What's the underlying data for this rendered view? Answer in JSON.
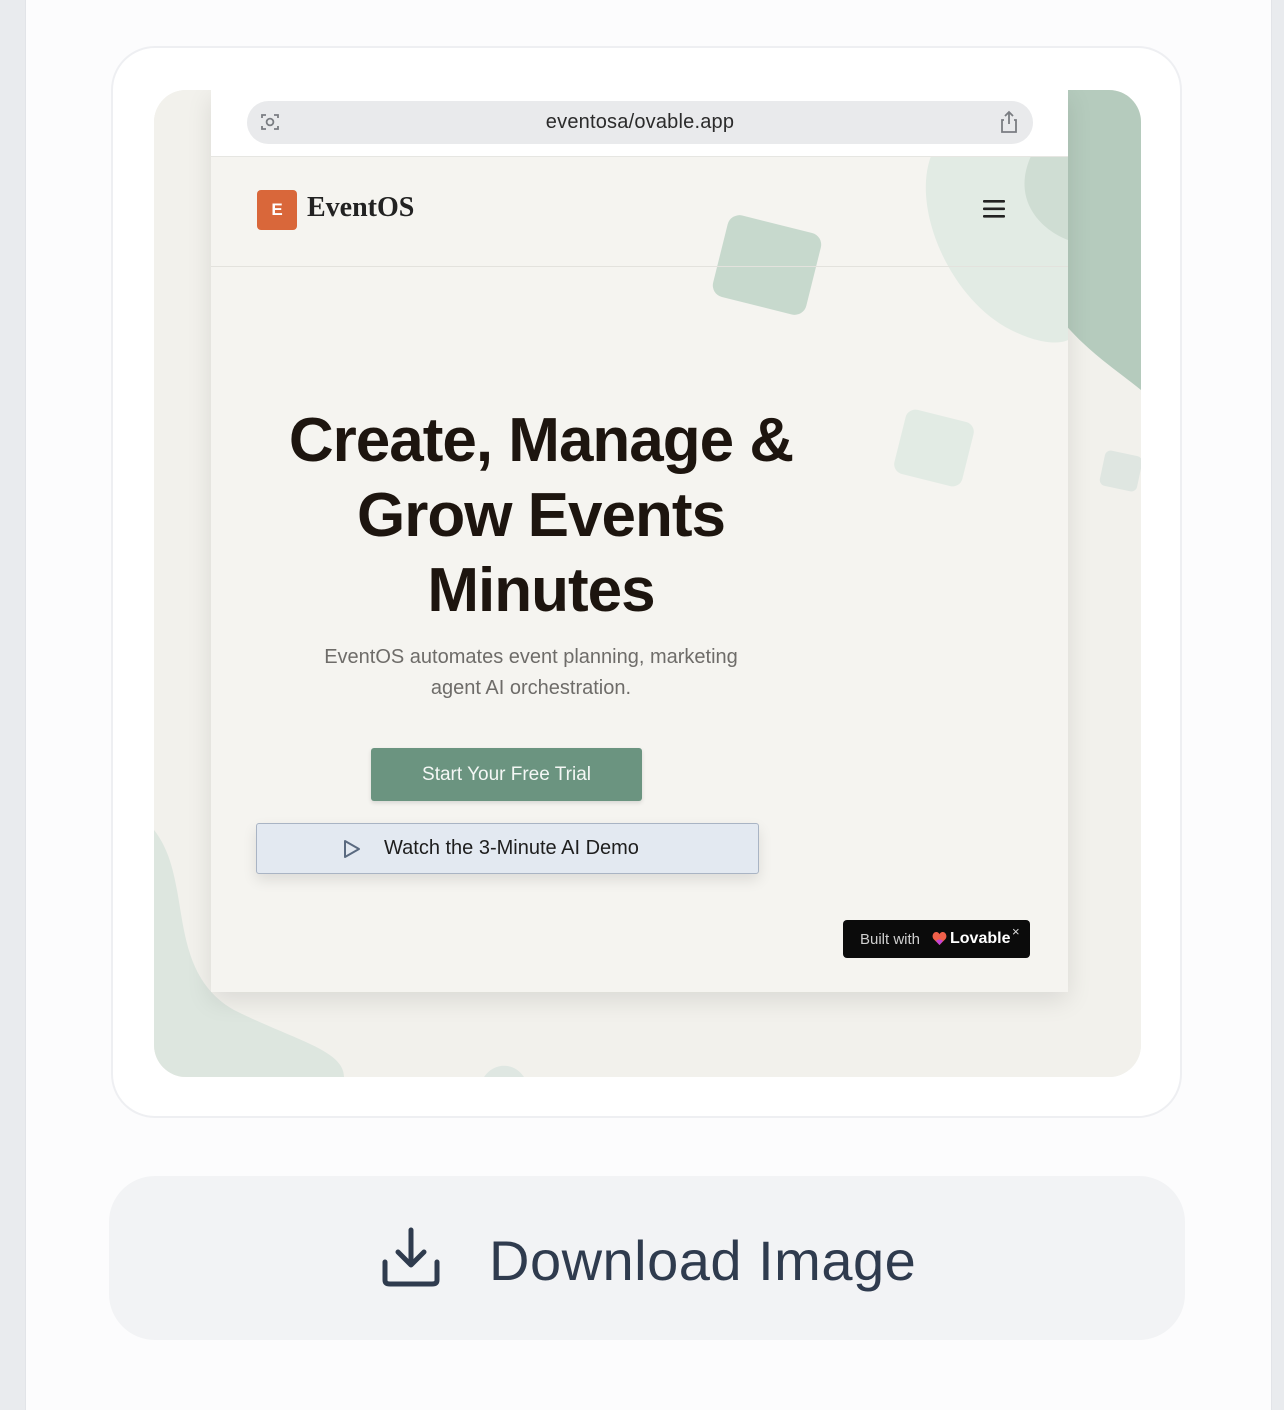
{
  "preview": {
    "browser": {
      "url": "eventosa/ovable.app",
      "icons": {
        "left": "camera-scan-icon",
        "right": "share-icon"
      }
    },
    "site": {
      "logo_letter": "E",
      "logo_text": "EventOS",
      "menu_icon": "hamburger-menu-icon",
      "hero_title_line1": "Create, Manage &",
      "hero_title_line2": "Grow Events",
      "hero_title_line3": "Minutes",
      "hero_subtitle_line1": "EventOS automates event planning, marketing",
      "hero_subtitle_line2": "agent AI orchestration.",
      "cta_primary": "Start Your Free Trial",
      "cta_secondary": "Watch the 3-Minute AI Demo",
      "badge_built": "Built with",
      "badge_brand": "Lovable",
      "badge_close": "×"
    },
    "colors": {
      "accent_green": "#6b9480",
      "logo_orange": "#d9673a",
      "page_bg": "#f5f4f0"
    }
  },
  "actions": {
    "download_label": "Download Image",
    "download_icon": "download-icon"
  }
}
